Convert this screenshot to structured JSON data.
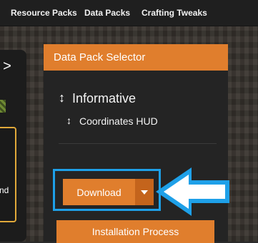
{
  "topnav": {
    "links": [
      "Resource Packs",
      "Data Packs",
      "Crafting Tweaks"
    ]
  },
  "left_panel": {
    "arrow_glyph": ">",
    "card_text_fragment": "nd"
  },
  "selector": {
    "title": "Data Pack Selector",
    "category": "Informative",
    "item": "Coordinates HUD",
    "sort_glyph": "↕"
  },
  "actions": {
    "download_label": "Download",
    "install_label": "Installation Process"
  },
  "colors": {
    "accent": "#e07e2d",
    "accent_dark": "#c4641c",
    "highlight": "#1ea0e8",
    "panel": "#242424",
    "nav": "#1f1f1f"
  },
  "icons": {
    "sort": "sort-updown-icon",
    "dropdown": "caret-down-icon",
    "pointer": "pointer-arrow-icon"
  }
}
